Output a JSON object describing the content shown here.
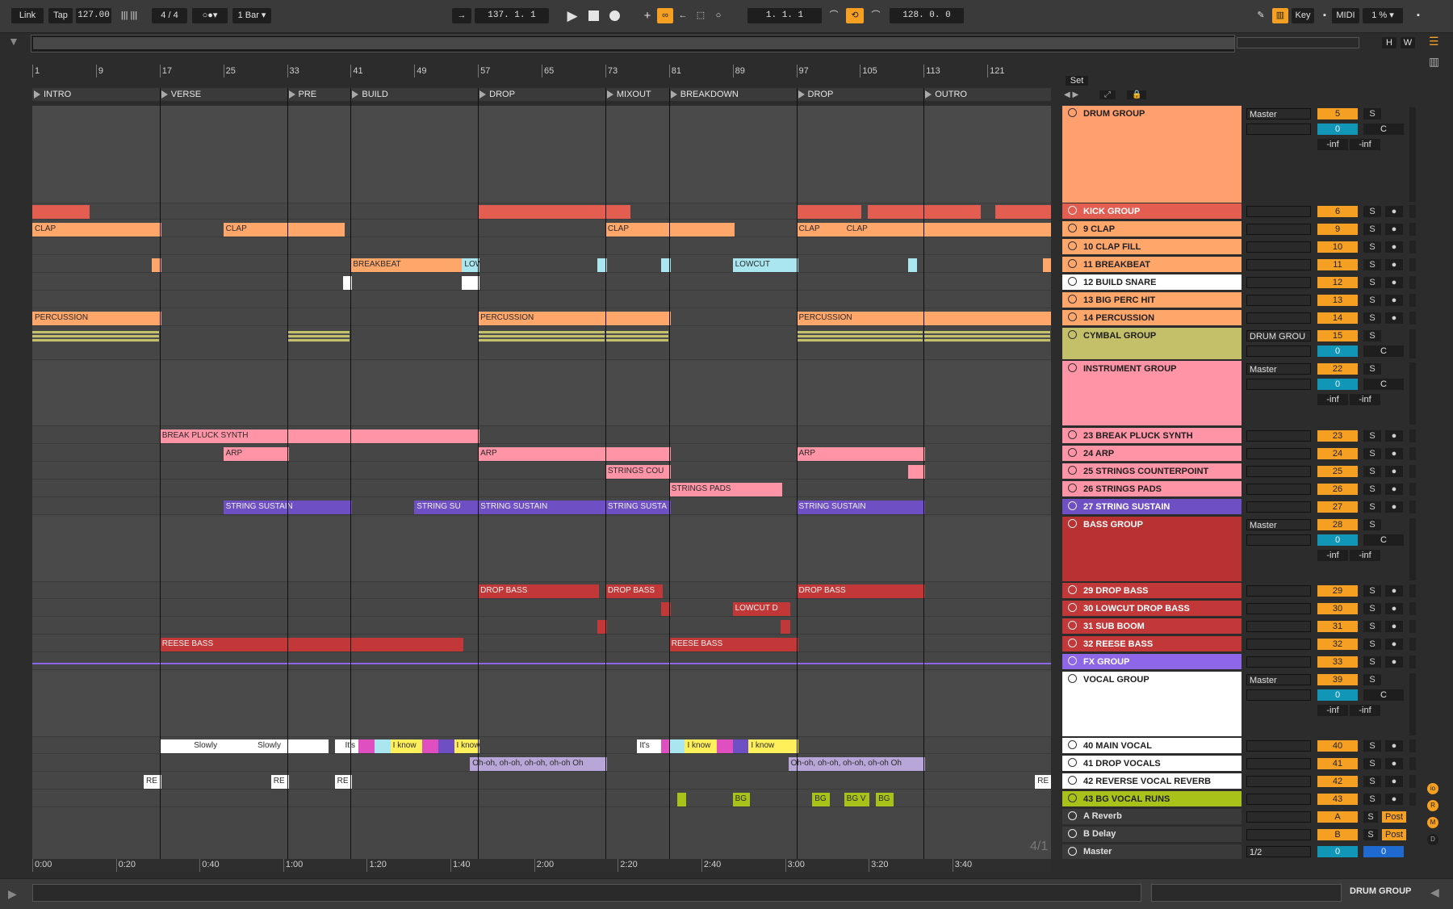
{
  "toolbar": {
    "link": "Link",
    "tap": "Tap",
    "tempo": "127.00",
    "time_signature": "4 / 4",
    "quantize": "1 Bar",
    "position": "137.  1.  1",
    "loop_start": "1.  1.  1",
    "loop_length": "128.  0.  0",
    "key": "Key",
    "midi": "MIDI",
    "cpu": "1 %"
  },
  "overview": {
    "h_label": "H",
    "w_label": "W"
  },
  "ruler": {
    "bars": [
      "1",
      "9",
      "17",
      "25",
      "33",
      "41",
      "49",
      "57",
      "65",
      "73",
      "81",
      "89",
      "97",
      "105",
      "113",
      "121"
    ]
  },
  "locators": [
    "INTRO",
    "VERSE",
    "PRE",
    "BUILD",
    "DROP",
    "MIXOUT",
    "BREAKDOWN",
    "DROP",
    "OUTRO"
  ],
  "set_panel": {
    "label": "Set"
  },
  "watermark": "4/1",
  "tracks": [
    {
      "name": "DRUM GROUP",
      "num": "5",
      "io": "Master",
      "vol": "0",
      "pan": "C",
      "peak_l": "-inf",
      "peak_r": "-inf",
      "s": "S",
      "color": "#ff9f6e"
    },
    {
      "name": "KICK GROUP",
      "num": "6",
      "s": "S",
      "color": "#e35d50"
    },
    {
      "name": "9 CLAP",
      "num": "9",
      "s": "S",
      "color": "#ffa66b"
    },
    {
      "name": "10 CLAP FILL",
      "num": "10",
      "s": "S",
      "color": "#ffa66b"
    },
    {
      "name": "11 BREAKBEAT",
      "num": "11",
      "s": "S",
      "color": "#ffa66b"
    },
    {
      "name": "12 BUILD SNARE",
      "num": "12",
      "s": "S",
      "color": "#ffffff"
    },
    {
      "name": "13 BIG PERC HIT",
      "num": "13",
      "s": "S",
      "color": "#ffa66b"
    },
    {
      "name": "14 PERCUSSION",
      "num": "14",
      "s": "S",
      "color": "#ffa66b"
    },
    {
      "name": "CYMBAL GROUP",
      "num": "15",
      "io": "DRUM GROU",
      "vol": "0",
      "pan": "C",
      "s": "S",
      "color": "#c4c06a"
    },
    {
      "name": "INSTRUMENT GROUP",
      "num": "22",
      "io": "Master",
      "vol": "0",
      "pan": "C",
      "peak_l": "-inf",
      "peak_r": "-inf",
      "s": "S",
      "color": "#ff94a6"
    },
    {
      "name": "23 BREAK PLUCK SYNTH",
      "num": "23",
      "s": "S",
      "color": "#ff94a6"
    },
    {
      "name": "24 ARP",
      "num": "24",
      "s": "S",
      "color": "#ff94a6"
    },
    {
      "name": "25 STRINGS COUNTERPOINT",
      "num": "25",
      "s": "S",
      "color": "#ff94a6"
    },
    {
      "name": "26 STRINGS PADS",
      "num": "26",
      "s": "S",
      "color": "#ff94a6"
    },
    {
      "name": "27 STRING SUSTAIN",
      "num": "27",
      "s": "S",
      "color": "#6e4fc4"
    },
    {
      "name": "BASS GROUP",
      "num": "28",
      "io": "Master",
      "vol": "0",
      "pan": "C",
      "peak_l": "-inf",
      "peak_r": "-inf",
      "s": "S",
      "color": "#b83232"
    },
    {
      "name": "29 DROP BASS",
      "num": "29",
      "s": "S",
      "color": "#c23838"
    },
    {
      "name": "30 LOWCUT  DROP BASS",
      "num": "30",
      "s": "S",
      "color": "#c23838"
    },
    {
      "name": "31 SUB BOOM",
      "num": "31",
      "s": "S",
      "color": "#c23838"
    },
    {
      "name": "32 REESE BASS",
      "num": "32",
      "s": "S",
      "color": "#c23838"
    },
    {
      "name": "FX GROUP",
      "num": "33",
      "s": "S",
      "color": "#8e67e8"
    },
    {
      "name": "VOCAL GROUP",
      "num": "39",
      "io": "Master",
      "vol": "0",
      "pan": "C",
      "peak_l": "-inf",
      "peak_r": "-inf",
      "s": "S",
      "color": "#ffffff"
    },
    {
      "name": "40 MAIN VOCAL",
      "num": "40",
      "s": "S",
      "color": "#ffffff"
    },
    {
      "name": "41 DROP VOCALS",
      "num": "41",
      "s": "S",
      "color": "#ffffff"
    },
    {
      "name": "42 REVERSE VOCAL REVERB",
      "num": "42",
      "s": "S",
      "color": "#ffffff"
    },
    {
      "name": "43 BG VOCAL RUNS",
      "num": "43",
      "s": "S",
      "color": "#a8c21a"
    }
  ],
  "returns": [
    {
      "name": "A Reverb",
      "num": "A",
      "s": "S",
      "post": "Post"
    },
    {
      "name": "B Delay",
      "num": "B",
      "s": "S",
      "post": "Post"
    }
  ],
  "master": {
    "name": "Master",
    "io": "1/2",
    "vol": "0",
    "pan": "0"
  },
  "clip_labels": {
    "clap": "CLAP",
    "breakbeat": "BREAKBEAT",
    "lowcut": "LOWCUT",
    "percussion": "PERCUSSION",
    "break_pluck": "BREAK PLUCK SYNTH",
    "arp": "ARP",
    "strings_cou": "STRINGS COU",
    "strings_pads": "STRINGS PADS",
    "string_sustain": "STRING SUSTAIN",
    "string_su": "STRING SU",
    "string_susta": "STRING SUSTA",
    "drop_bass": "DROP BASS",
    "lowcut_d": "LOWCUT D",
    "reese": "REESE BASS",
    "ohoh": "Oh-oh, oh-oh, oh-oh, oh-oh Oh",
    "slowly": "Slowly",
    "know": "I know",
    "its": "It's",
    "re": "RE",
    "bg": "BG",
    "bg_v": "BG V"
  },
  "time_labels": [
    "0:00",
    "0:20",
    "0:40",
    "1:00",
    "1:20",
    "1:40",
    "2:00",
    "2:20",
    "2:40",
    "3:00",
    "3:20",
    "3:40"
  ],
  "status": {
    "selected": "DRUM GROUP"
  }
}
